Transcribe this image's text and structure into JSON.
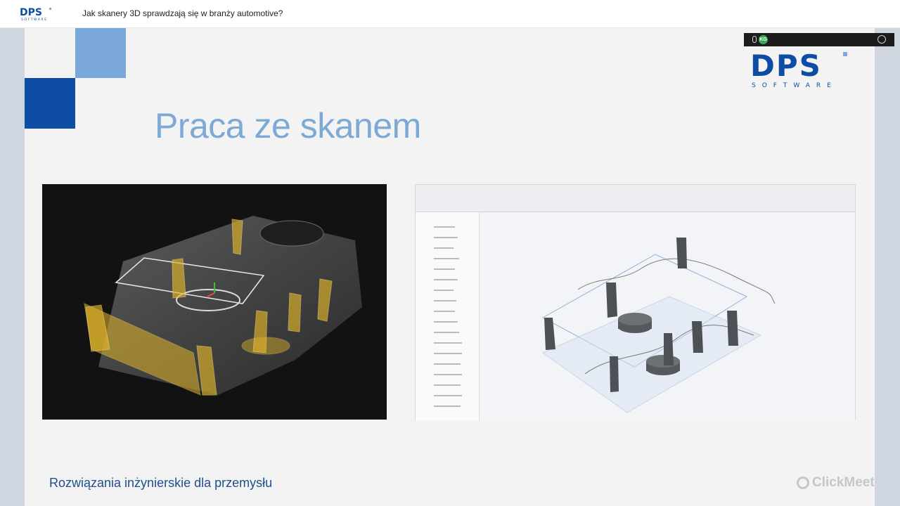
{
  "header": {
    "logo_text": "DPS SOFTWARE",
    "title": "Jak skanery 3D sprawdzają się w branży automotive?"
  },
  "overlay": {
    "avatar_initials": "KG"
  },
  "slide": {
    "title": "Praca ze skanem",
    "logo_text": "DPS SOFTWARE",
    "footer": "Rozwiązania inżynierskie dla przemysłu",
    "watermark": "ClickMeeting"
  },
  "colors": {
    "accent_dark": "#0d4da3",
    "accent_light": "#7aa8d9",
    "title": "#7ea9d4",
    "footer": "#1f4f8c"
  }
}
